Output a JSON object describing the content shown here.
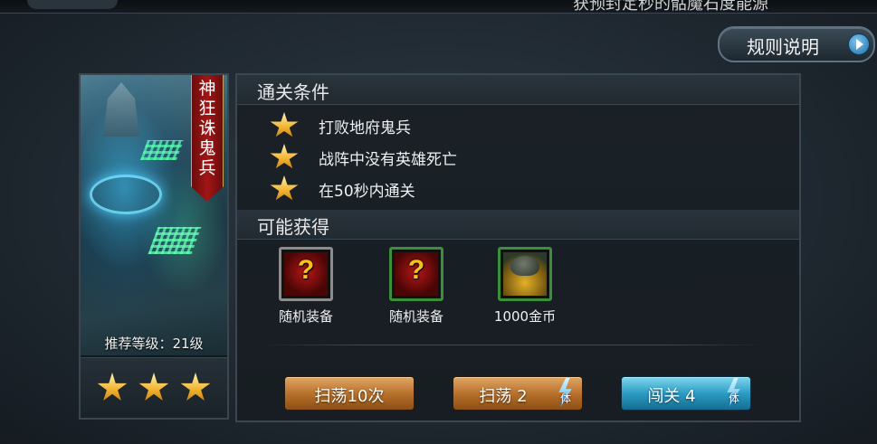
{
  "top": {
    "cut_text": "获预封定秒的骷魔石度能源"
  },
  "rules_button": {
    "label": "规则说明"
  },
  "stage": {
    "name": "神狂诛鬼兵",
    "recommended_level": "推荐等级：21级",
    "stars_earned": 3
  },
  "clear_conditions": {
    "title": "通关条件",
    "items": [
      "打败地府鬼兵",
      "战阵中没有英雄死亡",
      "在50秒内通关"
    ]
  },
  "rewards": {
    "title": "可能获得",
    "items": [
      {
        "label": "随机装备",
        "icon": "random-equipment-icon",
        "rarity_color": "#8c8c8c"
      },
      {
        "label": "随机装备",
        "icon": "random-equipment-icon",
        "rarity_color": "#3c8f3a"
      },
      {
        "label": "1000金币",
        "icon": "gold-coins-icon",
        "rarity_color": "#3c8f3a"
      }
    ]
  },
  "actions": {
    "sweep10": {
      "label": "扫荡10次"
    },
    "sweep": {
      "label": "扫荡 2",
      "stamina": "体"
    },
    "challenge": {
      "label": "闯关 4",
      "stamina": "体"
    }
  },
  "colors": {
    "orange_button": "#b9722c",
    "blue_button": "#2c9cc4",
    "banner_red": "#a11616",
    "star_gold": "#f2b430"
  }
}
